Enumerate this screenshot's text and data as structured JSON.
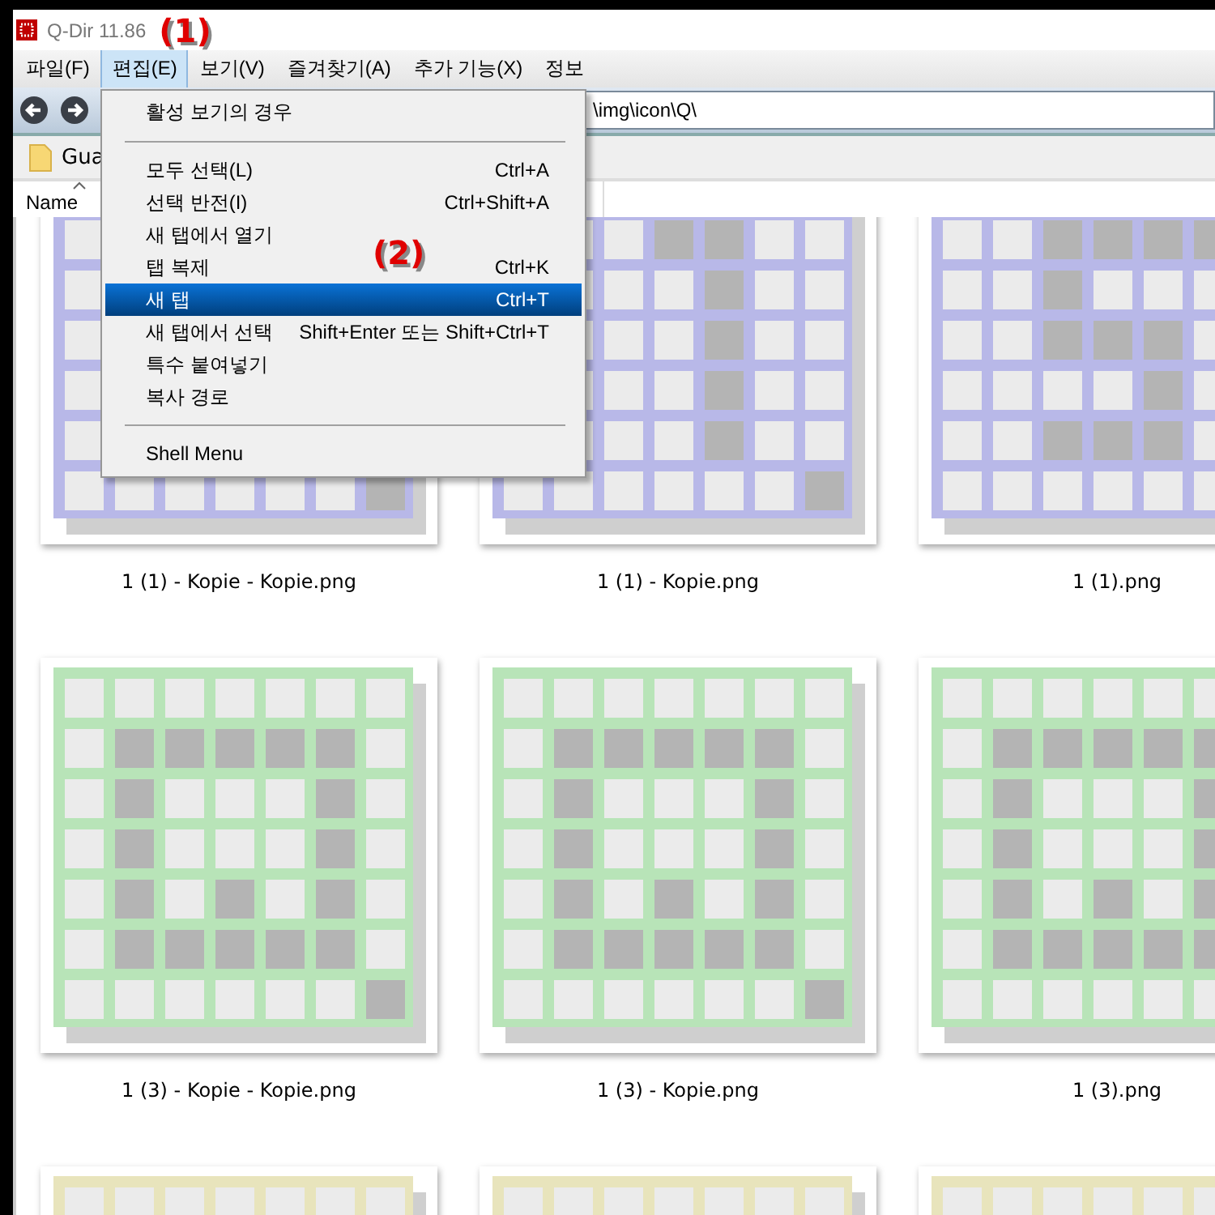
{
  "window": {
    "title": "Q-Dir 11.86"
  },
  "annotations": [
    {
      "text": "(1)"
    },
    {
      "text": "(2)"
    }
  ],
  "menubar": [
    {
      "label": "파일(F)",
      "selected": false
    },
    {
      "label": "편집(E)",
      "selected": true
    },
    {
      "label": "보기(V)",
      "selected": false
    },
    {
      "label": "즐겨찾기(A)",
      "selected": false
    },
    {
      "label": "추가 기능(X)",
      "selected": false
    },
    {
      "label": "정보",
      "selected": false
    }
  ],
  "address": {
    "value": "\\img\\icon\\Q\\"
  },
  "favorites": [
    {
      "label": "Gua"
    }
  ],
  "columns": [
    {
      "label": "Name",
      "sorted": true
    }
  ],
  "thumbnail_rows": [
    {
      "color": "#b8b8e8",
      "files": [
        "1 (1) - Kopie - Kopie.png",
        "1 (1) - Kopie.png",
        "1 (1).png"
      ]
    },
    {
      "color": "#b8e4b8",
      "files": [
        "1 (3) - Kopie - Kopie.png",
        "1 (3) - Kopie.png",
        "1 (3).png"
      ]
    },
    {
      "color": "#e8e4bc"
    }
  ],
  "menu": {
    "items": [
      {
        "kind": "header",
        "label": "활성 보기의 경우"
      },
      {
        "kind": "separator"
      },
      {
        "kind": "item",
        "label": "모두 선택(L)",
        "shortcut": "Ctrl+A",
        "selected": false
      },
      {
        "kind": "item",
        "label": "선택 반전(I)",
        "shortcut": "Ctrl+Shift+A",
        "selected": false
      },
      {
        "kind": "item",
        "label": "새 탭에서 열기",
        "selected": false
      },
      {
        "kind": "item",
        "label": "탭 복제",
        "shortcut": "Ctrl+K",
        "selected": false
      },
      {
        "kind": "item",
        "label": "새 탭",
        "shortcut": "Ctrl+T",
        "selected": true
      },
      {
        "kind": "item",
        "label": "새 탭에서 선택",
        "shortcut": "Shift+Enter 또는 Shift+Ctrl+T",
        "selected": false
      },
      {
        "kind": "item",
        "label": "특수 붙여넣기",
        "selected": false
      },
      {
        "kind": "item",
        "label": "복사 경로",
        "selected": false
      },
      {
        "kind": "separator"
      },
      {
        "kind": "item",
        "label": "Shell Menu",
        "selected": false
      }
    ]
  }
}
